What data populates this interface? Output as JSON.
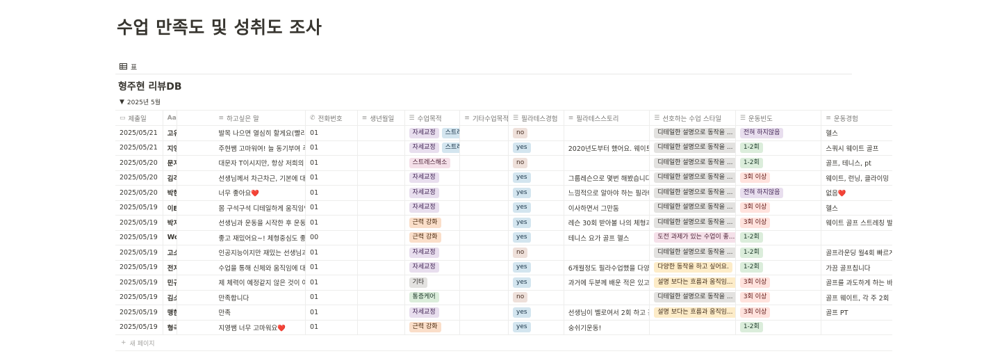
{
  "page": {
    "title": "수업 만족도 및 성취도 조사"
  },
  "view": {
    "icon": "table-icon",
    "label": "표"
  },
  "database": {
    "title": "형주현 리뷰DB",
    "group": {
      "arrow": "▼",
      "label": "2025년 5월"
    }
  },
  "columns": [
    {
      "icon": "▭",
      "label": "제출일"
    },
    {
      "icon": "Aa",
      "label": "이름"
    },
    {
      "icon": "",
      "label": ""
    },
    {
      "icon": "≡",
      "label": "하고싶은 말"
    },
    {
      "icon": "✆",
      "label": "전화번호"
    },
    {
      "icon": "≡",
      "label": "생년월일"
    },
    {
      "icon": "☰",
      "label": "수업목적"
    },
    {
      "icon": "≡",
      "label": "기타수업목적"
    },
    {
      "icon": "☰",
      "label": "필라테스경험"
    },
    {
      "icon": "≡",
      "label": "필라테스스토리"
    },
    {
      "icon": "☰",
      "label": "선호하는 수업 스타일"
    },
    {
      "icon": "☰",
      "label": "운동빈도"
    },
    {
      "icon": "≡",
      "label": "운동경험"
    }
  ],
  "rows": [
    {
      "date": "2025/05/21",
      "name": "고유",
      "msg": "발목 나으면 열심히 할게요(빨리낫",
      "phone": "01",
      "purpose": [
        "자세교정",
        "스트레"
      ],
      "purpose_colors": [
        "purple",
        "blue"
      ],
      "pilates": "no",
      "story": "",
      "style": "디테일한 설명으로 동작을 ...",
      "style_color": "gray",
      "style2": "",
      "freq": "전혀 하지않음",
      "freq_color": "purple",
      "exp": "헬스"
    },
    {
      "date": "2025/05/21",
      "name": "지영",
      "msg": "주현쌤 고마워여! 늘 동기부여 주고",
      "phone": "01",
      "purpose": [
        "자세교정",
        "스트레"
      ],
      "purpose_colors": [
        "purple",
        "blue"
      ],
      "pilates": "yes",
      "story": "2020년도부터 했어요. 웨이트만 하",
      "style": "디테일한 설명으로 동작을 ...",
      "style_color": "gray",
      "style2": "",
      "freq": "1-2회",
      "freq_color": "green",
      "exp": "스쿼시 웨이트 골프"
    },
    {
      "date": "2025/05/20",
      "name": "문지",
      "msg": "대문자 T이시지만, 항상 저희의 동",
      "phone": "01",
      "purpose": [
        "스트레스해소"
      ],
      "purpose_colors": [
        "pink"
      ],
      "pilates": "no",
      "story": "",
      "style": "디테일한 설명으로 동작을 ...",
      "style_color": "gray",
      "style2": "",
      "freq": "1-2회",
      "freq_color": "green",
      "exp": "골프, 테니스, pt"
    },
    {
      "date": "2025/05/20",
      "name": "김각",
      "msg": "선생님께서 차근차근, 기본에 대한",
      "phone": "01",
      "purpose": [
        "자세교정"
      ],
      "purpose_colors": [
        "purple"
      ],
      "pilates": "yes",
      "story": "그룹레슨으로 몇번 해봤습니다! 고",
      "style": "디테일한 설명으로 동작을 ...",
      "style_color": "gray",
      "style2": "",
      "freq": "3회 이상",
      "freq_color": "red",
      "exp": "웨이트, 런닝, 클라이밍"
    },
    {
      "date": "2025/05/20",
      "name": "박현",
      "msg": "너무 좋아요❤️",
      "phone": "01",
      "purpose": [
        "자세교정"
      ],
      "purpose_colors": [
        "purple"
      ],
      "pilates": "yes",
      "story": "느낌적으로 알아야 하는 필라테스",
      "style": "디테일한 설명으로 동작을 ...",
      "style_color": "gray",
      "style2": "",
      "freq": "전혀 하지않음",
      "freq_color": "purple",
      "exp": "없음❤️"
    },
    {
      "date": "2025/05/19",
      "name": "이B",
      "msg": "몸 구석구석 디테일하게 움직임인",
      "phone": "01",
      "purpose": [
        "자세교정"
      ],
      "purpose_colors": [
        "purple"
      ],
      "pilates": "yes",
      "story": "이사하면서 그만둠",
      "style": "디테일한 설명으로 동작을 ...",
      "style_color": "gray",
      "style2": "",
      "freq": "3회 이상",
      "freq_color": "red",
      "exp": "헬스"
    },
    {
      "date": "2025/05/19",
      "name": "박지",
      "msg": "선생님과 운동을 시작한 후 운동에",
      "phone": "01",
      "purpose": [
        "근력 강화"
      ],
      "purpose_colors": [
        "orange"
      ],
      "pilates": "yes",
      "story": "레슨 30회 받아볼 나의 체형과 움직",
      "style": "디테일한 설명으로 동작을 ...",
      "style_color": "gray",
      "style2": "",
      "freq": "3회 이상",
      "freq_color": "red",
      "exp": "웨이트 골프 스트레칭 발레"
    },
    {
      "date": "2025/05/19",
      "name": "Wo",
      "msg": "좋고 재밌어요~! 체형중심도 좋지",
      "phone": "00",
      "purpose": [
        "근력 강화"
      ],
      "purpose_colors": [
        "orange"
      ],
      "pilates": "yes",
      "story": "테니스 요가 골프 헬스",
      "style": "도전 과제가 있는 수업이 좋...",
      "style_color": "pink",
      "style2": "",
      "freq": "1-2회",
      "freq_color": "green",
      "exp": ""
    },
    {
      "date": "2025/05/19",
      "name": "고소",
      "msg": "인공지능이지만 재밌는 선생님과",
      "phone": "01",
      "purpose": [
        "자세교정"
      ],
      "purpose_colors": [
        "purple"
      ],
      "pilates": "no",
      "story": "",
      "style": "디테일한 설명으로 동작을 ...",
      "style_color": "gray",
      "style2": "",
      "freq": "1-2회",
      "freq_color": "green",
      "exp": "골프라운딩 월4회 빠르게걷"
    },
    {
      "date": "2025/05/19",
      "name": "전지",
      "msg": "수업을 통해 신체와 움직임에 대한",
      "phone": "01",
      "purpose": [
        "자세교정"
      ],
      "purpose_colors": [
        "purple"
      ],
      "pilates": "yes",
      "story": "6개월정도 필라수업했을 다양한 지",
      "style": "다양한 동작을 하고 싶어요.",
      "style_color": "yellow",
      "style2": "설",
      "freq": "1-2회",
      "freq_color": "green",
      "exp": "가끔 골프칩니다"
    },
    {
      "date": "2025/05/19",
      "name": "민규",
      "msg": "제 체력이 예정같지 않은 것이 아쉽",
      "phone": "01",
      "purpose": [
        "기타"
      ],
      "purpose_colors": [
        "gray"
      ],
      "pilates": "yes",
      "story": "과거에 두분께 배운 적은 있고, 주요",
      "style": "설명 보다는 흐름과 움직임...",
      "style_color": "yellow",
      "style2": "",
      "freq": "3회 이상",
      "freq_color": "red",
      "exp": "골프를 과도하게 하는 바람에"
    },
    {
      "date": "2025/05/19",
      "name": "김소",
      "msg": "만족합니다",
      "phone": "01",
      "purpose": [
        "통증케어"
      ],
      "purpose_colors": [
        "green"
      ],
      "pilates": "no",
      "story": "",
      "style": "디테일한 설명으로 동작을 ...",
      "style_color": "gray",
      "style2": "",
      "freq": "3회 이상",
      "freq_color": "red",
      "exp": "골프 웨이트, 각 주 2회"
    },
    {
      "date": "2025/05/19",
      "name": "맹한",
      "msg": "만족",
      "phone": "01",
      "purpose": [
        "자세교정"
      ],
      "purpose_colors": [
        "purple"
      ],
      "pilates": "yes",
      "story": "선생님이 벨로여서 2회 하고 관둠",
      "style": "설명 보다는 흐름과 움직임...",
      "style_color": "yellow",
      "style2": "",
      "freq": "3회 이상",
      "freq_color": "red",
      "exp": "골프 PT"
    },
    {
      "date": "2025/05/19",
      "name": "형극",
      "msg": "지영쌤 너무 고마워요❤️",
      "phone": "01",
      "purpose": [
        "근력 강화"
      ],
      "purpose_colors": [
        "orange"
      ],
      "pilates": "yes",
      "story": "숭쉬기운동!",
      "style": "",
      "style_color": "gray",
      "style2": "",
      "freq": "1-2회",
      "freq_color": "green",
      "exp": ""
    }
  ],
  "pilates_colors": {
    "no": "brown",
    "yes": "blue"
  },
  "new_page": {
    "icon": "+",
    "label": "새 페이지"
  }
}
